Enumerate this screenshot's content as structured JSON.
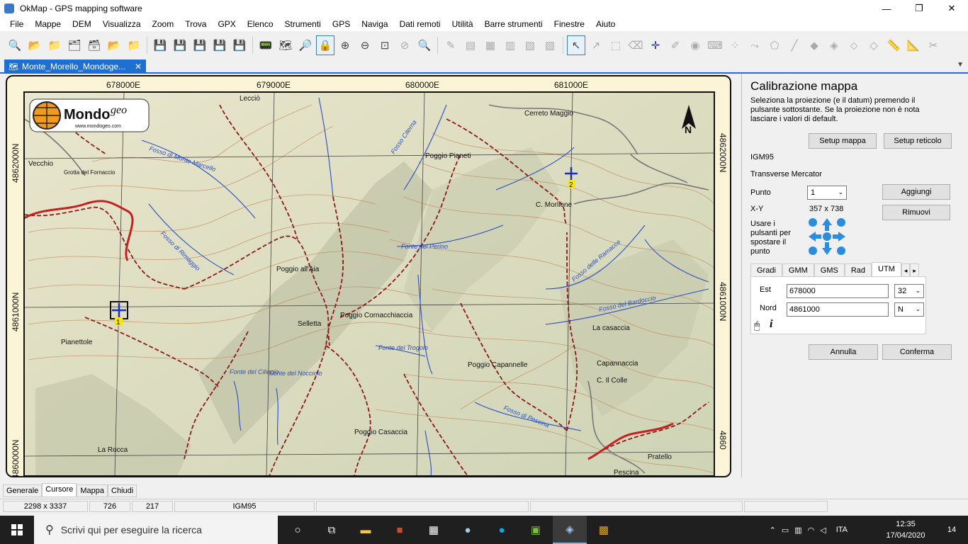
{
  "window": {
    "title": "OkMap - GPS mapping software",
    "minimize": "—",
    "maximize": "❐",
    "close": "✕"
  },
  "menu": [
    "File",
    "Mappe",
    "DEM",
    "Visualizza",
    "Zoom",
    "Trova",
    "GPX",
    "Elenco",
    "Strumenti",
    "GPS",
    "Naviga",
    "Dati remoti",
    "Utilità",
    "Barre strumenti",
    "Finestre",
    "Aiuto"
  ],
  "document_tab": {
    "label": "Monte_Morello_Mondoge...",
    "close": "✕"
  },
  "map": {
    "top_ticks": [
      "678000E",
      "679000E",
      "680000E",
      "681000E"
    ],
    "left_ticks": [
      "4862000N",
      "4861000N",
      "4860000N"
    ],
    "right_ticks": [
      "4862000N",
      "4861000N",
      "4860"
    ],
    "logo_main": "Mondo",
    "logo_sup": "geo",
    "logo_url": "www.mondogeo.com",
    "north": "N",
    "point1_label": "1",
    "point2_label": "2",
    "places": [
      "Poggio Pianeti",
      "Poggio all'Aia",
      "Poggio Cornacchiaccia",
      "Poggio Capannelle",
      "Poggio Casaccia",
      "Cerreto Maggio",
      "C. Morlione",
      "Capannaccia",
      "C. Il Colle",
      "La casaccia",
      "Pianettole",
      "La Rocca",
      "Pratello",
      "Pescina",
      "Selletta",
      "Vecchio",
      "Grotta del Fornaccio",
      "Lecciò",
      "Fonte del Perino",
      "Fonte del Trogolo",
      "Fonte del Ciliegio",
      "Fonte del Nocciolo",
      "Fosso di Monte Marcello",
      "Fosso di Rimaggio",
      "Fosso delle Ramacce",
      "Fosso del Bardoccio",
      "Fosso di Pescina",
      "Fosso Citerna"
    ]
  },
  "calib": {
    "title": "Calibrazione mappa",
    "description": "Seleziona la proiezione (e il datum) premendo il pulsante sottostante. Se la proiezione non è nota lasciare i valori di default.",
    "setup_map": "Setup mappa",
    "setup_grid": "Setup reticolo",
    "datum": "IGM95",
    "projection": "Transverse Mercator",
    "punto_label": "Punto",
    "punto_value": "1",
    "add": "Aggiungi",
    "remove": "Rimuovi",
    "xy_label": "X-Y",
    "xy_value": "357 x 738",
    "move_hint": "Usare i pulsanti per spostare il punto",
    "tabs": [
      "Gradi",
      "GMM",
      "GMS",
      "Rad",
      "UTM"
    ],
    "est_label": "Est",
    "est_value": "678000",
    "zone_value": "32",
    "nord_label": "Nord",
    "nord_value": "4861000",
    "hemi_value": "N",
    "cancel": "Annulla",
    "confirm": "Conferma"
  },
  "bottom_tabs": [
    "Generale",
    "Cursore",
    "Mappa",
    "Chiudi"
  ],
  "status": [
    "2298 x 3337",
    "726",
    "217",
    "IGM95"
  ],
  "taskbar": {
    "search_placeholder": "Scrivi qui per eseguire la ricerca",
    "lang": "ITA",
    "time": "12:35",
    "date": "17/04/2020",
    "notifications": "14"
  },
  "colors": {
    "accent": "#1e6fd2",
    "trail": "#8b1a1a",
    "stream": "#2a4fc4",
    "contour": "#b86a3a"
  }
}
